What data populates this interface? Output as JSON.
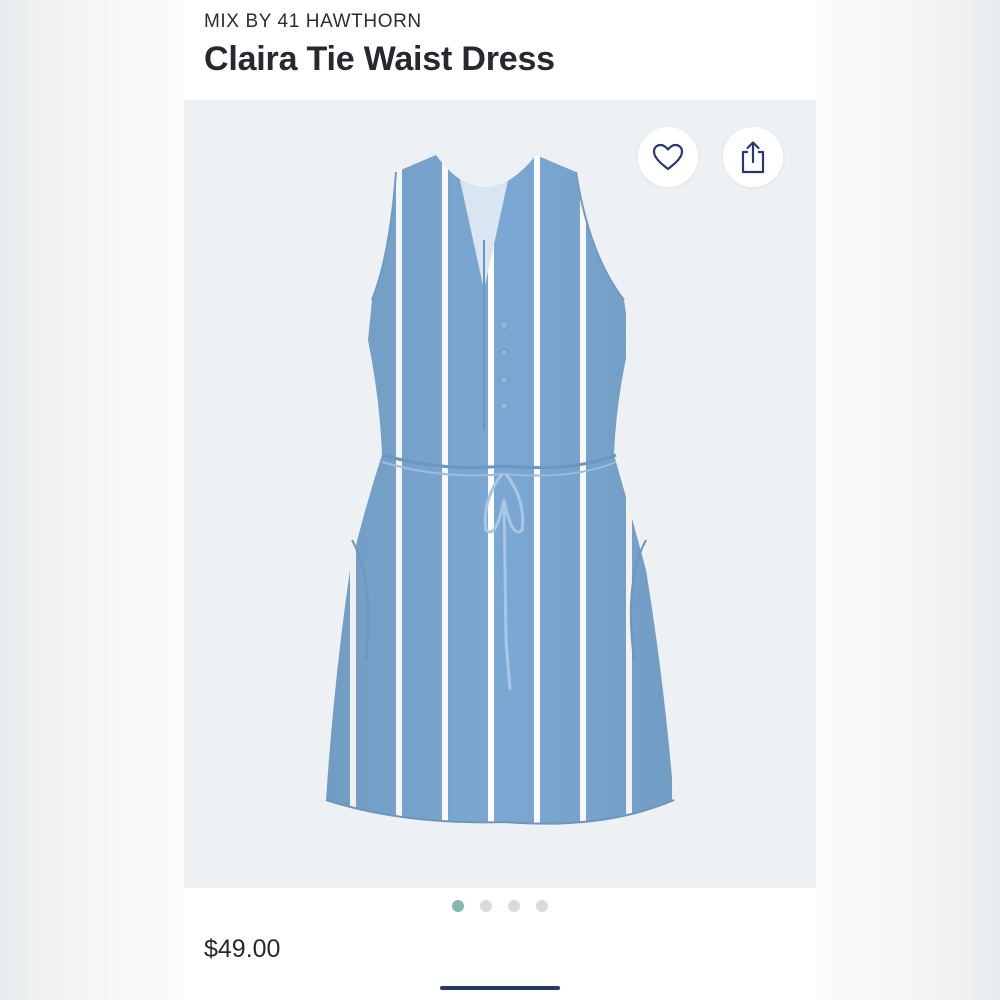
{
  "product": {
    "brand": "MIX BY 41 HAWTHORN",
    "name": "Claira Tie Waist Dress",
    "price": "$49.00",
    "image_alt": "Claira Tie Waist Dress"
  },
  "gallery": {
    "total_images": 4,
    "active_index": 0
  },
  "actions": {
    "favorite_icon": "heart-outline-icon",
    "share_icon": "share-upload-icon"
  },
  "colors": {
    "active_dot": "#84b8ad",
    "inactive_dot": "#d7dade",
    "image_background": "#eef1f3",
    "dress_blue": "#7aa8d2",
    "home_indicator": "#243a6b"
  }
}
